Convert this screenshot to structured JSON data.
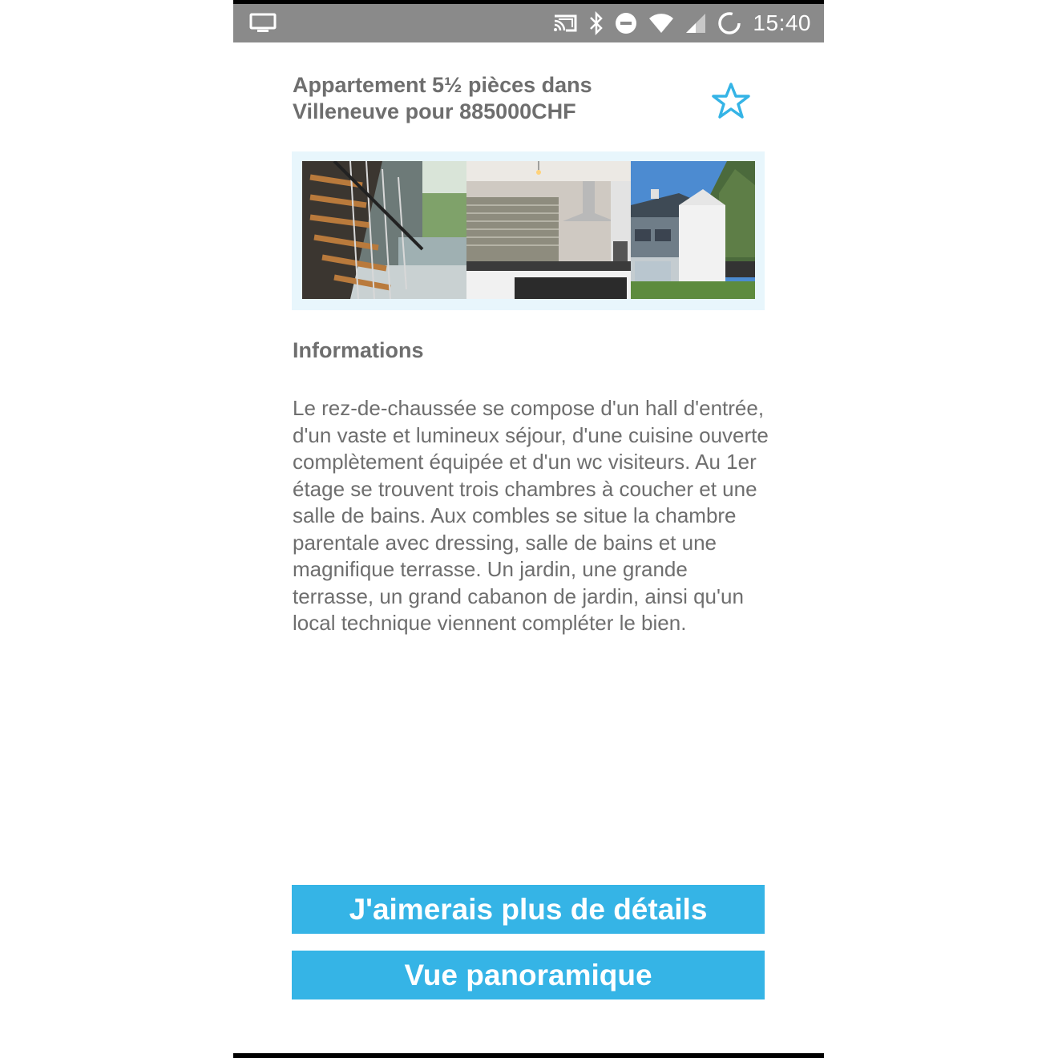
{
  "status_bar": {
    "time": "15:40",
    "icons": [
      "screen-icon",
      "cast-icon",
      "bluetooth-icon",
      "do-not-disturb-icon",
      "wifi-icon",
      "cell-signal-icon",
      "battery-icon"
    ]
  },
  "listing": {
    "title": "Appartement 5½ pièces dans Villeneuve pour 885000CHF",
    "favorite_icon": "star-outline-icon",
    "accent_color": "#35b4e6",
    "photos": [
      "staircase-photo",
      "kitchen-photo",
      "house-exterior-photo"
    ]
  },
  "info": {
    "heading": "Informations",
    "description": "Le rez-de-chaussée se compose d'un hall d'entrée, d'un vaste et lumineux séjour, d'une cuisine ouverte complètement équipée et d'un wc visiteurs. Au 1er étage se trouvent trois chambres à coucher et une salle de bains. Aux combles se situe la chambre parentale avec dressing, salle de bains et une magnifique terrasse. Un jardin, une grande terrasse, un grand cabanon de jardin, ainsi qu'un local technique viennent compléter le bien."
  },
  "actions": {
    "details_label": "J'aimerais plus de détails",
    "panorama_label": "Vue panoramique"
  }
}
